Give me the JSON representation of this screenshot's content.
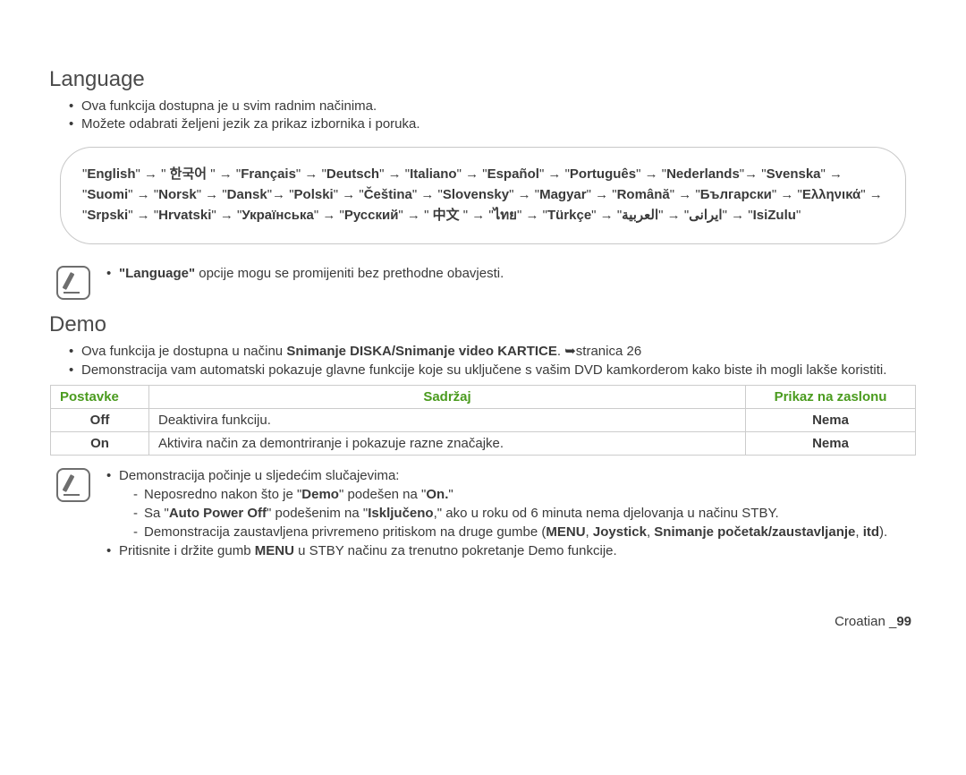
{
  "language": {
    "title": "Language",
    "bullets": [
      "Ova funkcija dostupna je u svim radnim načinima.",
      "Možete odabrati željeni jezik za prikaz izbornika i poruka."
    ],
    "chain_html": "\"<b>English</b>\" → \" <b>한국어</b> \" → \"<b>Français</b>\" → \"<b>Deutsch</b>\" → \"<b>Italiano</b>\" → \"<b>Español</b>\" → \"<b>Português</b>\" → \"<b>Nederlands</b>\"→ \"<b>Svenska</b>\" → \"<b>Suomi</b>\" → \"<b>Norsk</b>\" → \"<b>Dansk</b>\"→ \"<b>Polski</b>\" → \"<b>Čeština</b>\" → \"<b>Slovensky</b>\" → \"<b>Magyar</b>\" → \"<b>Română</b>\" → \"<b>Български</b>\" → \"<b>Ελληνικά</b>\" → \"<b>Srpski</b>\" → \"<b>Hrvatski</b>\" → \"<b>Українська</b>\" → \"<b>Русский</b>\" → \" <b>中文</b> \" → \"<b>ไทย</b>\" → \"<b>Türkçe</b>\" → \"<b>ایرانی</b>\" → \"<b>العربية</b>\" → \"<b>IsiZulu</b>\"",
    "note_html": "<b>\"Language\"</b> opcije mogu se promijeniti bez prethodne obavjesti."
  },
  "demo": {
    "title": "Demo",
    "intro_html": [
      "Ova funkcija je dostupna u načinu <b>Snimanje DISKA/Snimanje video KARTICE</b>. ➥stranica 26",
      "Demonstracija vam automatski pokazuje glavne funkcije koje su uključene s vašim DVD kamkorderom kako biste ih mogli lakše koristiti."
    ],
    "table": {
      "headers": [
        "Postavke",
        "Sadržaj",
        "Prikaz na zaslonu"
      ],
      "rows": [
        {
          "setting": "Off",
          "desc": "Deaktivira funkciju.",
          "display": "Nema"
        },
        {
          "setting": "On",
          "desc": "Aktivira način za demontriranje i pokazuje razne značajke.",
          "display": "Nema"
        }
      ]
    },
    "note1_intro": "Demonstracija počinje u sljedećim slučajevima:",
    "note1_items_html": [
      "Neposredno nakon što je \"<b>Demo</b>\" podešen na \"<b>On.</b>\"",
      "Sa \"<b>Auto Power Off</b>\" podešenim na \"<b>Isključeno</b>,\" ako u roku od 6 minuta nema djelovanja u načinu STBY.",
      "Demonstracija zaustavljena privremeno pritiskom na druge gumbe (<b>MENU</b>, <b>Joystick</b>, <b>Snimanje početak/zaustavljanje</b>, <b>itd</b>)."
    ],
    "note2_html": "Pritisnite i držite gumb <b>MENU</b> u STBY načinu za trenutno pokretanje Demo funkcije."
  },
  "footer": {
    "lang": "Croatian _",
    "page": "99"
  }
}
